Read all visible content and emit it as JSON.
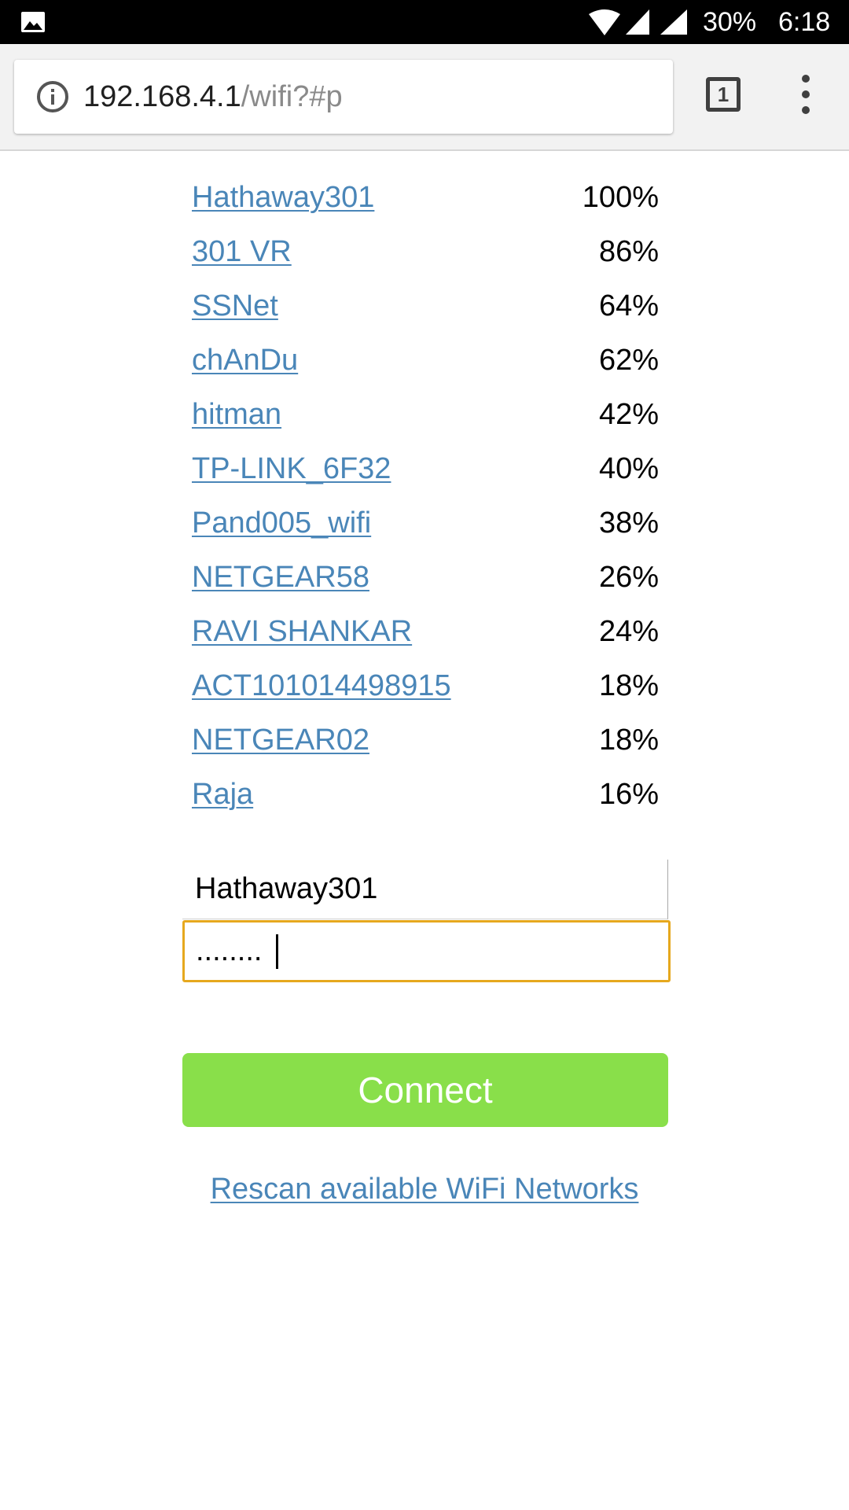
{
  "status_bar": {
    "battery": "30%",
    "time": "6:18",
    "icons": [
      "gallery-icon",
      "wifi-icon",
      "cell-signal-icon",
      "cell-signal-icon"
    ]
  },
  "browser": {
    "url_host": "192.168.4.1",
    "url_path": "/wifi?#p",
    "tab_count": "1",
    "icons": [
      "info-icon",
      "tabs-icon",
      "more-vert-icon"
    ]
  },
  "networks": [
    {
      "ssid": "Hathaway301",
      "signal": "100%"
    },
    {
      "ssid": "301 VR",
      "signal": "86%"
    },
    {
      "ssid": "SSNet",
      "signal": "64%"
    },
    {
      "ssid": "chAnDu",
      "signal": "62%"
    },
    {
      "ssid": "hitman",
      "signal": "42%"
    },
    {
      "ssid": "TP-LINK_6F32",
      "signal": "40%"
    },
    {
      "ssid": "Pand005_wifi",
      "signal": "38%"
    },
    {
      "ssid": "NETGEAR58",
      "signal": "26%"
    },
    {
      "ssid": "RAVI SHANKAR",
      "signal": "24%"
    },
    {
      "ssid": "ACT101014498915",
      "signal": "18%"
    },
    {
      "ssid": "NETGEAR02",
      "signal": "18%"
    },
    {
      "ssid": "Raja",
      "signal": "16%"
    }
  ],
  "form": {
    "ssid_value": "Hathaway301",
    "password_value": "........",
    "connect_label": "Connect",
    "rescan_label": "Rescan available WiFi Networks"
  },
  "colors": {
    "link": "#4a86b8",
    "connect_button": "#89df4a",
    "focus_border": "#e6a81e"
  }
}
